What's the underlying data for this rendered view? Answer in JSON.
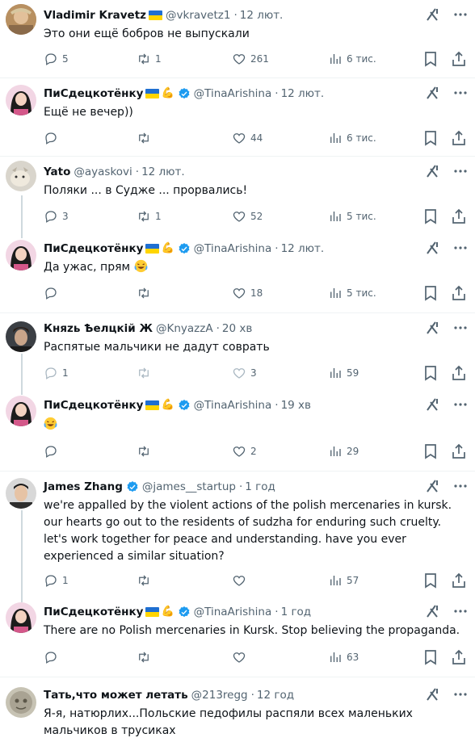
{
  "tweets": [
    {
      "name": "Vladimir Kravetz",
      "flag": true,
      "verified": false,
      "handle": "@vkravetz1",
      "time": "12 лют.",
      "text": "Это они ещё бобров не выпускали",
      "replies": "5",
      "retweets": "1",
      "likes": "261",
      "views": "6 тис.",
      "actions_disabled": false
    },
    {
      "name": "ПиСдецкотёнку",
      "flag": true,
      "verified": true,
      "handle": "@TinaArishina",
      "time": "12 лют.",
      "text": "Ещё не вечер))",
      "replies": "",
      "retweets": "",
      "likes": "44",
      "views": "6 тис.",
      "actions_disabled": false
    },
    {
      "name": "Yato",
      "flag": false,
      "verified": false,
      "handle": "@ayaskovi",
      "time": "12 лют.",
      "text": "Поляки ... в Судже ... прорвались!",
      "replies": "3",
      "retweets": "1",
      "likes": "52",
      "views": "5 тис.",
      "actions_disabled": false
    },
    {
      "name": "ПиСдецкотёнку",
      "flag": true,
      "verified": true,
      "handle": "@TinaArishina",
      "time": "12 лют.",
      "text": "Да ужас, прям",
      "replies": "",
      "retweets": "",
      "likes": "18",
      "views": "5 тис.",
      "actions_disabled": false
    },
    {
      "name": "Княzь Ѣелцкій Ж",
      "flag": false,
      "verified": false,
      "handle": "@KnyazzA",
      "time": "20 хв",
      "text": "Распятые мальчики не дадут соврать",
      "replies": "1",
      "retweets": "",
      "likes": "3",
      "views": "59",
      "actions_disabled": true
    },
    {
      "name": "ПиСдецкотёнку",
      "flag": true,
      "verified": true,
      "handle": "@TinaArishina",
      "time": "19 хв",
      "text": "",
      "replies": "",
      "retweets": "",
      "likes": "2",
      "views": "29",
      "actions_disabled": false
    },
    {
      "name": "James Zhang",
      "flag": false,
      "verified": true,
      "handle": "@james__startup",
      "time": "1 год",
      "text": "we're appalled by the violent actions of the polish mercenaries in kursk. our hearts go out to the residents of sudzha for enduring such cruelty. let's work together for peace and understanding. have you ever experienced a similar situation?",
      "replies": "1",
      "retweets": "",
      "likes": "",
      "views": "57",
      "actions_disabled": false
    },
    {
      "name": "ПиСдецкотёнку",
      "flag": true,
      "verified": true,
      "handle": "@TinaArishina",
      "time": "1 год",
      "text": "There are no Polish mercenaries in Kursk.  Stop believing the propaganda.",
      "replies": "",
      "retweets": "",
      "likes": "",
      "views": "63",
      "actions_disabled": false
    },
    {
      "name": "Тать,что может летать",
      "flag": false,
      "verified": false,
      "handle": "@213regg",
      "time": "12 год",
      "text": "Я-я, натюрлих...Польские педофилы распяли всех маленьких мальчиков в трусиках",
      "replies": "",
      "retweets": "",
      "likes": "",
      "views": "",
      "actions_disabled": false
    }
  ],
  "icons": {
    "reply": "reply-icon",
    "retweet": "retweet-icon",
    "like": "heart-icon",
    "views": "views-icon",
    "bookmark": "bookmark-icon",
    "share": "share-icon",
    "grok": "grok-icon",
    "more": "more-icon",
    "verified": "verified-badge-icon",
    "laugh": "laughing-emoji-icon"
  },
  "colors": {
    "text": "#0f1419",
    "secondary": "#536471",
    "verified": "#1d9bf0",
    "divider": "#eff3f4",
    "thread": "#cfd9de"
  }
}
